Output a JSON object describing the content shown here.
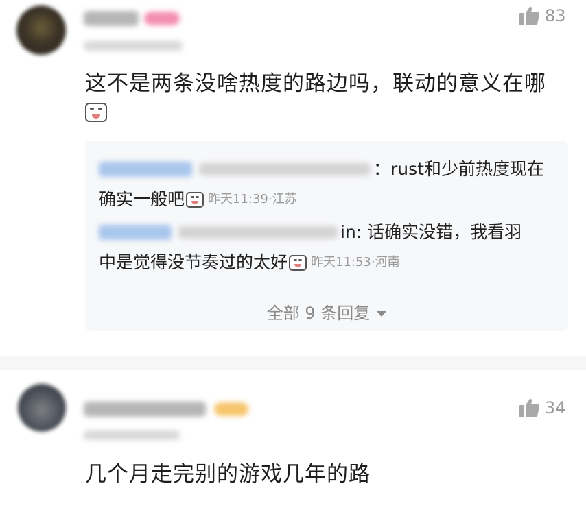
{
  "comments": [
    {
      "likes": "83",
      "text": "这不是两条没啥热度的路边吗，联动的意义在哪",
      "replies": [
        {
          "prefix_visible": "：rust和少前热度现在",
          "line2": "确实一般吧",
          "meta": "昨天11:39·江苏"
        },
        {
          "prefix_visible": "in: 话确实没错，我看羽",
          "line2": "中是觉得没节奏过的太好",
          "meta": "昨天11:53·河南"
        }
      ],
      "view_all": "全部 9 条回复"
    },
    {
      "likes": "34",
      "text": "几个月走完别的游戏几年的路"
    }
  ],
  "colors": {
    "badge_pink": "#f48fb1",
    "badge_gold": "#f7c56b",
    "muted": "#9a9a9a"
  },
  "icons": {
    "like": "thumbs-up-icon",
    "emoji": "crying-laugh-emoji-icon",
    "caret": "caret-down-icon"
  }
}
